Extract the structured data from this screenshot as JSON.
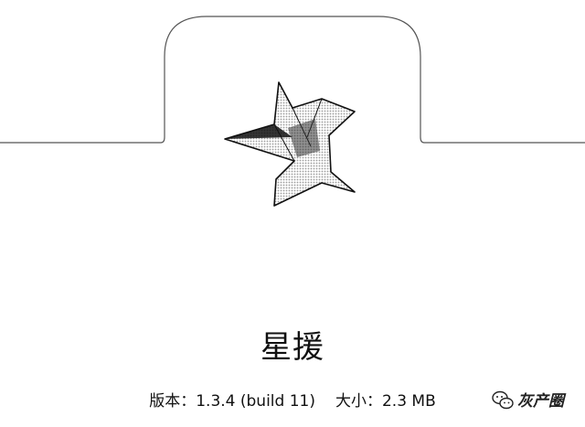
{
  "app": {
    "name": "星援",
    "version_label": "版本：",
    "version_value": "1.3.4 (build 11)",
    "size_label": "大小：",
    "size_value": "2.3 MB",
    "icon": "star-icon"
  },
  "watermark": {
    "icon": "wechat-icon",
    "text": "灰产圈"
  },
  "colors": {
    "background": "#ffffff",
    "line": "#555555",
    "text": "#111111"
  }
}
